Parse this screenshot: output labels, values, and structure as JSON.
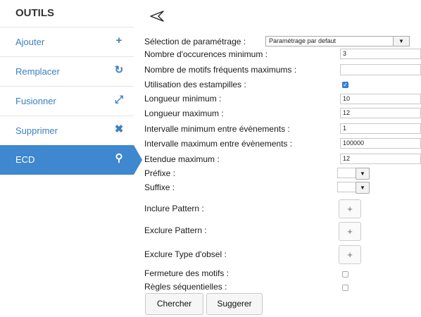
{
  "sidebar": {
    "title": "OUTILS",
    "items": [
      {
        "label": "Ajouter",
        "icon": "+"
      },
      {
        "label": "Remplacer",
        "icon": "↻"
      },
      {
        "label": "Fusionner",
        "icon": "⤢"
      },
      {
        "label": "Supprimer",
        "icon": "✖"
      },
      {
        "label": "ECD",
        "icon": "⚲"
      }
    ],
    "active_index": 4
  },
  "form": {
    "selection_label": "Sélection de paramétrage :",
    "selection_value": "Paramétrage par defaut",
    "min_occurrences_label": "Nombre d'occurences minimum :",
    "min_occurrences_value": "3",
    "max_patterns_label": "Nombre de motifs fréquents maximums :",
    "max_patterns_value": "",
    "timestamps_label": "Utilisation des estampilles :",
    "timestamps_checked": true,
    "min_length_label": "Longueur minimum :",
    "min_length_value": "10",
    "max_length_label": "Longueur maximum :",
    "max_length_value": "12",
    "min_interval_label": "Intervalle minimum entre évènements :",
    "min_interval_value": "1",
    "max_interval_label": "Intervalle maximum entre évènements :",
    "max_interval_value": "100000",
    "max_extent_label": "Etendue maximum :",
    "max_extent_value": "12",
    "prefix_label": "Préfixe :",
    "suffix_label": "Suffixe :",
    "include_pattern_label": "Inclure Pattern :",
    "exclude_pattern_label": "Exclure Pattern :",
    "exclude_obsel_label": "Exclure Type d'obsel :",
    "plus_symbol": "+",
    "closure_label": "Fermeture des motifs :",
    "closure_checked": false,
    "sequential_label": "Règles séquentielles :",
    "sequential_checked": false,
    "search_button": "Chercher",
    "suggest_button": "Suggerer"
  },
  "colors": {
    "accent": "#3f87cf",
    "link": "#3b7fc4",
    "checkbox": "#3a86d8"
  }
}
